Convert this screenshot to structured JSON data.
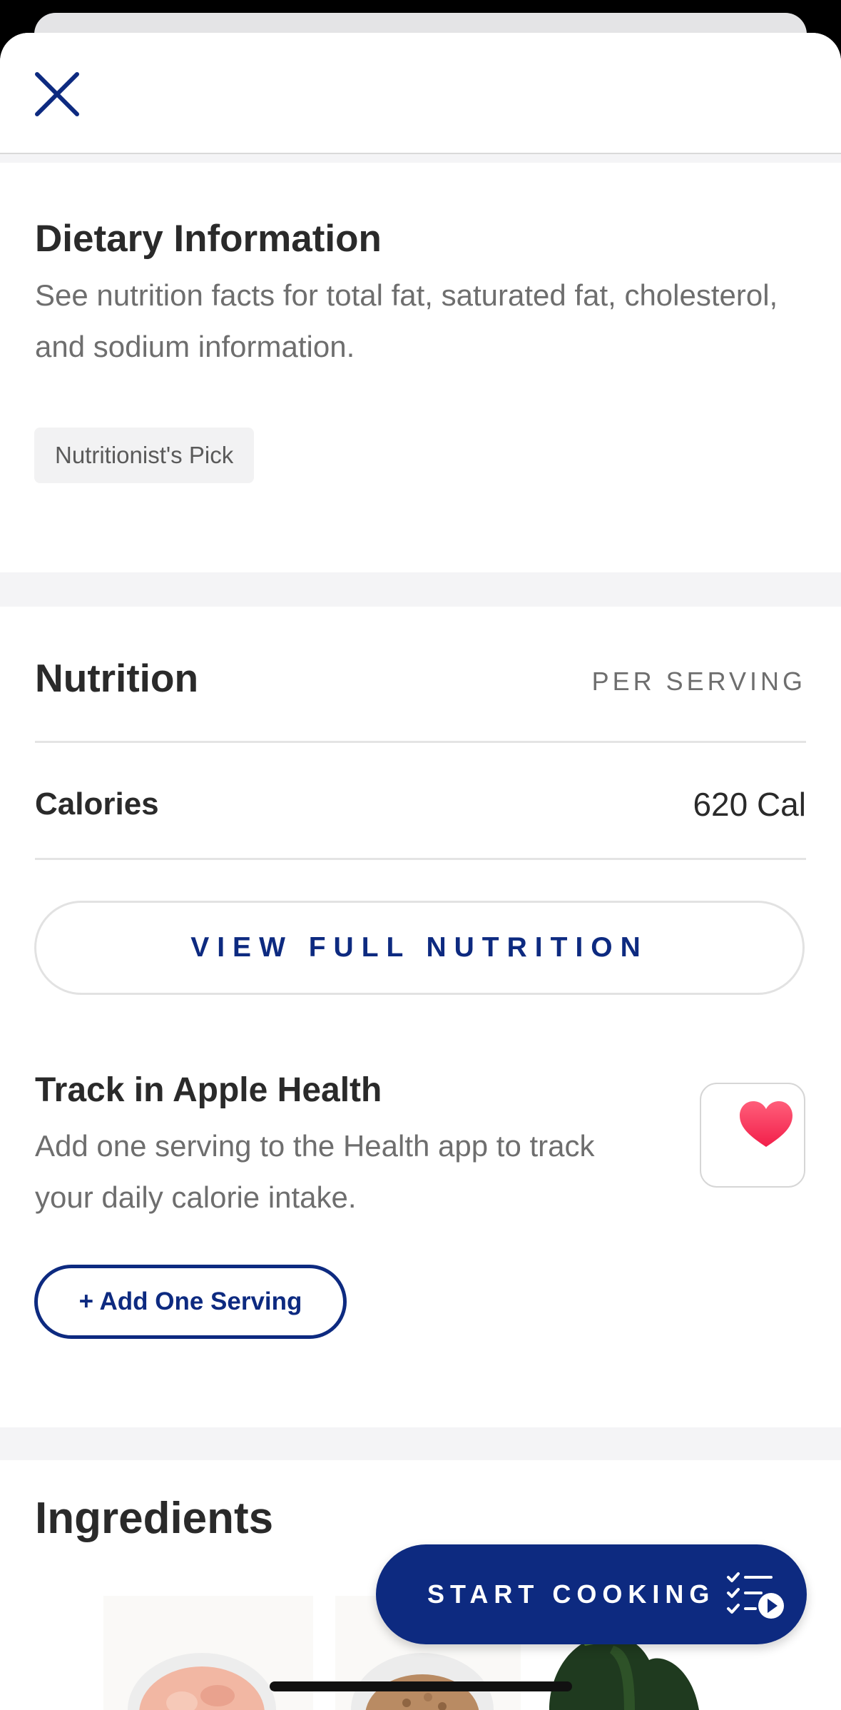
{
  "dietary": {
    "title": "Dietary Information",
    "description": "See nutrition facts for total fat, saturated fat, cholesterol, and sodium information.",
    "tag": "Nutritionist's Pick"
  },
  "nutrition": {
    "title": "Nutrition",
    "per_serving": "PER SERVING",
    "calories_label": "Calories",
    "calories_value": "620 Cal",
    "view_full_label": "VIEW FULL NUTRITION"
  },
  "apple_health": {
    "title": "Track in Apple Health",
    "description": "Add one serving to the Health app to track your daily calorie intake.",
    "add_button": "+ Add One Serving",
    "icon": "heart-icon"
  },
  "ingredients": {
    "title": "Ingredients"
  },
  "footer": {
    "start_cooking": "START COOKING"
  },
  "colors": {
    "brand_blue": "#0d2a80",
    "heart": "#f5355a",
    "section_gap": "#f4f4f6"
  }
}
